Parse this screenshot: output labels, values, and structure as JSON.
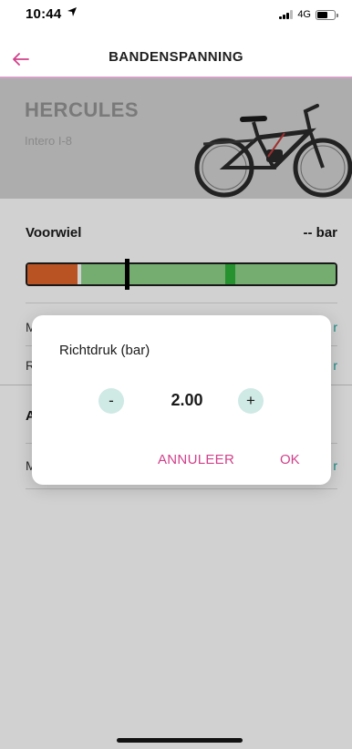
{
  "status_bar": {
    "time": "10:44",
    "location_icon": "location-arrow-icon",
    "network": "4G",
    "signal_icon": "signal-bars-icon",
    "battery_icon": "battery-icon"
  },
  "nav": {
    "back_icon": "back-arrow-icon",
    "title": "BANDENSPANNING",
    "accent_color": "#d0418a"
  },
  "bike": {
    "brand": "HERCULES",
    "model": "Intero I-8",
    "image_icon": "e-bike-image"
  },
  "wheel": {
    "label": "Voorwiel",
    "value": "-- bar"
  },
  "background_rows": [
    {
      "text": "M",
      "link": "r"
    },
    {
      "text": "R",
      "link": "r"
    }
  ],
  "section": {
    "label": "A"
  },
  "section_rows": [
    {
      "text": "M",
      "link": "r"
    }
  ],
  "dialog": {
    "title": "Richtdruk (bar)",
    "minus_label": "-",
    "plus_label": "+",
    "value": "2.00",
    "cancel_label": "ANNULEER",
    "ok_label": "OK"
  },
  "colors": {
    "gauge_low": "#e2662c",
    "gauge_ok": "#8fd38a",
    "gauge_target": "#2fb13a",
    "stepper_bg": "#cfe9e4",
    "link": "#1aa7a0"
  }
}
